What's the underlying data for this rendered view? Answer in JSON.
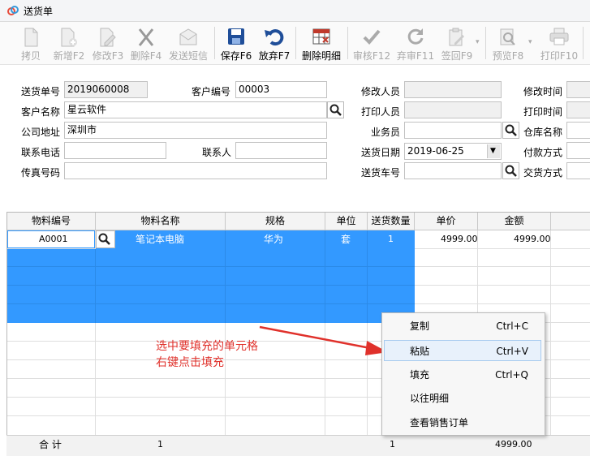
{
  "window": {
    "title": "送货单"
  },
  "toolbar": {
    "copy": "拷贝",
    "new": "新增F2",
    "edit": "修改F3",
    "delete": "删除F4",
    "sms": "发送短信",
    "save": "保存F6",
    "discard": "放弃F7",
    "delete_detail": "删除明细",
    "audit": "审核F12",
    "unaudit": "弃审F11",
    "sign_back": "签回F9",
    "preview": "预览F8",
    "print": "打印F10"
  },
  "form": {
    "order_no_label": "送货单号",
    "order_no": "2019060008",
    "customer_no_label": "客户编号",
    "customer_no": "00003",
    "customer_name_label": "客户名称",
    "customer_name": "星云软件",
    "address_label": "公司地址",
    "address": "深圳市",
    "phone_label": "联系电话",
    "phone": "",
    "contact_label": "联系人",
    "contact": "",
    "fax_label": "传真号码",
    "fax": "",
    "modifier_label": "修改人员",
    "modifier": "",
    "printer_label": "打印人员",
    "printer": "",
    "salesman_label": "业务员",
    "salesman": "",
    "date_label": "送货日期",
    "date": "2019-06-25",
    "vehicle_label": "送货车号",
    "vehicle": "",
    "modify_time_label": "修改时间",
    "modify_time": "",
    "print_time_label": "打印时间",
    "print_time": "",
    "warehouse_label": "仓库名称",
    "warehouse": "",
    "payment_label": "付款方式",
    "payment": "",
    "delivery_label": "交货方式",
    "delivery": ""
  },
  "grid": {
    "columns": [
      "物料编号",
      "物料名称",
      "规格",
      "单位",
      "送货数量",
      "单价",
      "金额"
    ],
    "rows": [
      {
        "code": "A0001",
        "name": "笔记本电脑",
        "spec": "华为",
        "unit": "套",
        "qty": "1",
        "price": "4999.00",
        "amount": "4999.00"
      }
    ],
    "totals": {
      "label": "合 计",
      "count": "1",
      "qty": "1",
      "amount": "4999.00"
    }
  },
  "context_menu": {
    "items": [
      {
        "label": "复制",
        "shortcut": "Ctrl+C"
      },
      {
        "label": "粘贴",
        "shortcut": "Ctrl+V"
      },
      {
        "label": "填充",
        "shortcut": "Ctrl+Q"
      },
      {
        "label": "以往明细",
        "shortcut": ""
      },
      {
        "label": "查看销售订单",
        "shortcut": ""
      }
    ]
  },
  "annotation": {
    "line1": "选中要填充的单元格",
    "line2": "右键点击填充"
  },
  "colors": {
    "selection": "#3399ff",
    "annotation": "#e0312b",
    "save_blue": "#1f4e99"
  }
}
